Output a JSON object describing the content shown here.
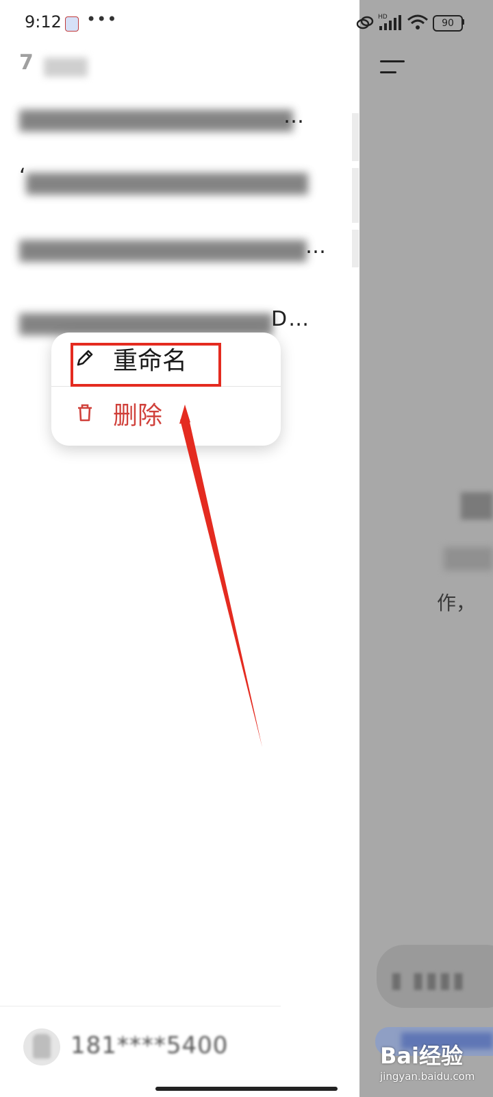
{
  "status_bar": {
    "time": "9:12",
    "more": "•••",
    "battery": "90",
    "icons": [
      "app-notification-icon",
      "link-icon",
      "signal-hd-icon",
      "wifi-icon",
      "battery-icon"
    ]
  },
  "drawer": {
    "section_label": "7",
    "history": [
      {
        "tail": "…"
      },
      {
        "lead": "‘"
      },
      {
        "tail": "…"
      },
      {
        "tail": "D…"
      }
    ]
  },
  "context_menu": {
    "rename_label": "重命名",
    "delete_label": "删除",
    "rename_icon": "pencil-icon",
    "delete_icon": "trash-icon",
    "delete_color": "#d0413b"
  },
  "right_pane": {
    "visible_text": "作，"
  },
  "footer": {
    "phone": "181****5400"
  },
  "annotation": {
    "highlight_color": "#e42b20"
  },
  "watermark": {
    "logo": "Bai经验",
    "url": "jingyan.baidu.com"
  }
}
